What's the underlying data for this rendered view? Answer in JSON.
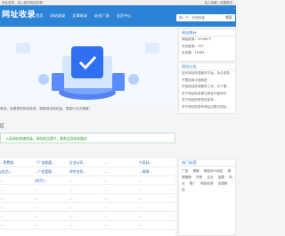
{
  "topbar": {
    "left": "网址收录，加入我们网站收录！",
    "right": "加入收藏 | 设置首页"
  },
  "header": {
    "logo": "网址收录",
    "search_placeholder": "搜一下，你就知道",
    "search_button": "搜索"
  },
  "nav": [
    "首页",
    "网站收录",
    "文章收录",
    "站长广场",
    "会员中心"
  ],
  "tip": "原创，免费提供网站收录，提高网站网站量，提高行业正确度！",
  "section_title": "区",
  "links_box": "·   入驻网站快速收录，网站商品提升，尊贵会员收录服务",
  "grid": [
    [
      "...免费版",
      "「广告联盟...",
      "企业公司...",
      "...",
      "宁夏站..."
    ],
    [
      "[站点]...",
      "...广告管理...",
      "综合业务...",
      "...",
      "...网络..."
    ],
    [
      "...",
      "[站点]...",
      "...",
      "...",
      "..."
    ],
    [
      "...",
      "...",
      "...",
      "...",
      "..."
    ],
    [
      "...",
      "...",
      "...",
      "...",
      "..."
    ],
    [
      "...",
      "...",
      "...",
      "...",
      "..."
    ],
    [
      "...",
      "...",
      "...",
      "...",
      "..."
    ],
    [
      "...",
      "...",
      "...",
      "...",
      "..."
    ]
  ],
  "stats": {
    "title": "网站统计",
    "rows": [
      "网站收录：37990个",
      "今日收录：797",
      "点击量：10481"
    ]
  },
  "announce": {
    "title": "网站公告",
    "rows": [
      "站长网站收录服务平台，永久收录",
      "不限站网中途转型",
      "开放网站收录服务工作，为了更...",
      "关于网站收录提交网址外链资讯",
      "关于网站收录排名相关...",
      "关于网站收录申请站点提交网址..."
    ]
  },
  "tags_panel": {
    "title": "热门标签",
    "tags": [
      "广告",
      "视频",
      "网站SEO优化",
      "网络营销",
      "外贸",
      "企业",
      "加盟",
      "站点",
      "推广",
      "网站收录",
      "全国网站"
    ]
  }
}
